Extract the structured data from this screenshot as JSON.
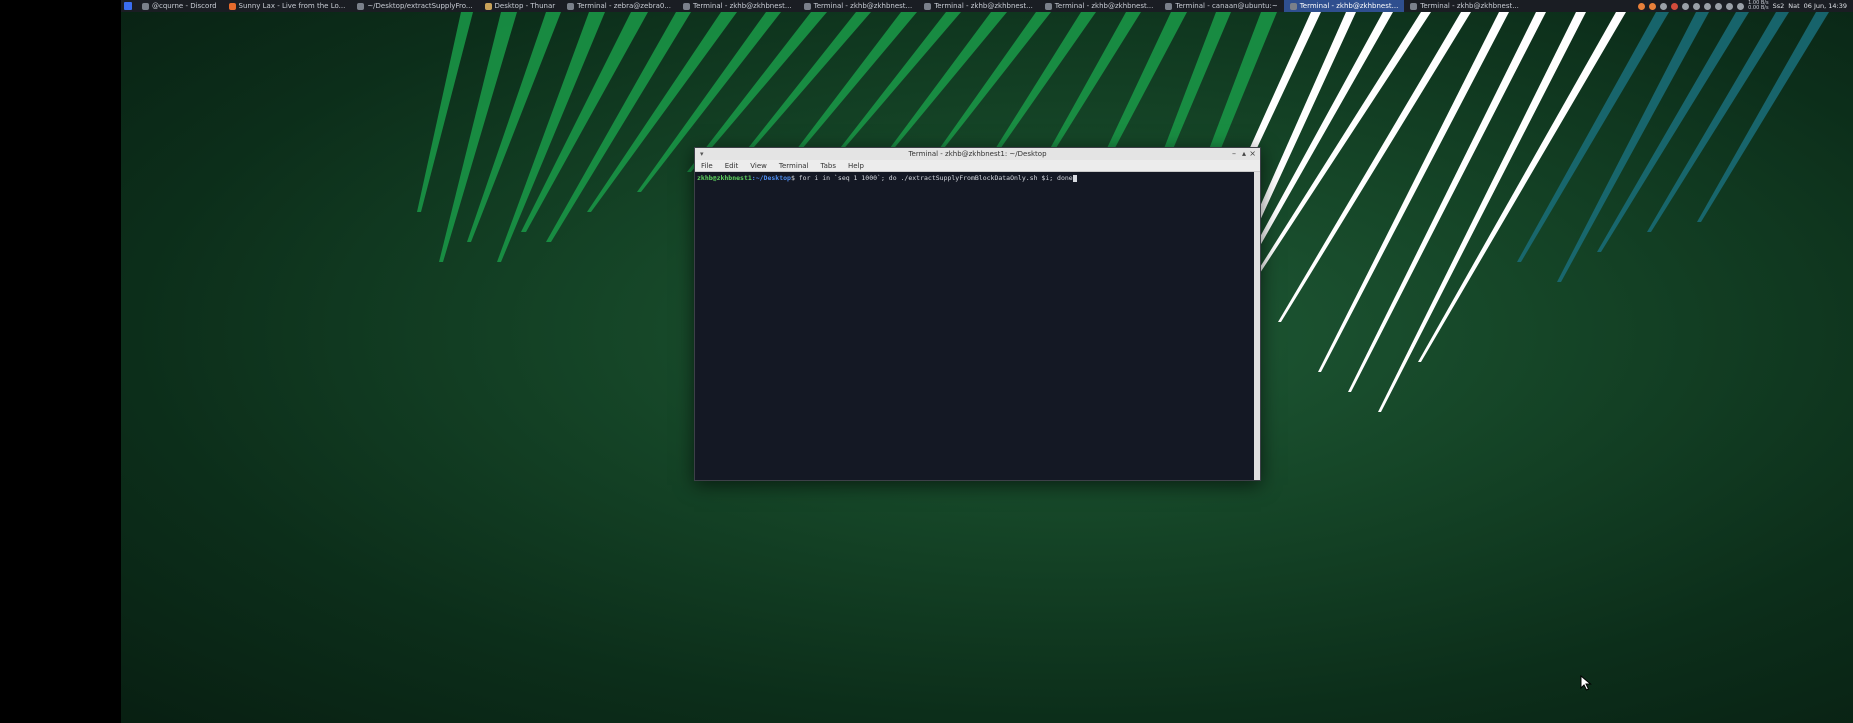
{
  "taskbar": {
    "tasks": [
      {
        "label": "@cqurne - Discord"
      },
      {
        "label": "Sunny Lax - Live from the Lo..."
      },
      {
        "label": "~/Desktop/extractSupplyFro..."
      },
      {
        "label": "Desktop - Thunar"
      },
      {
        "label": "Terminal - zebra@zebra0..."
      },
      {
        "label": "Terminal - zkhb@zkhbnest..."
      },
      {
        "label": "Terminal - zkhb@zkhbnest..."
      },
      {
        "label": "Terminal - zkhb@zkhbnest..."
      },
      {
        "label": "Terminal - zkhb@zkhbnest..."
      },
      {
        "label": "Terminal - canaan@ubuntu:~"
      },
      {
        "label": "Terminal - zkhb@zkhbnest..."
      },
      {
        "label": "Terminal - zkhb@zkhbnest..."
      }
    ],
    "active_index": 10,
    "tray": {
      "net_up": "1.00 B/s",
      "net_down": "0.00 B/s",
      "lang": "Ss2",
      "keyboard": "Nat",
      "clock": "06 Jun, 14:39"
    }
  },
  "terminal": {
    "title": "Terminal - zkhb@zkhbnest1: ~/Desktop",
    "menu": [
      "File",
      "Edit",
      "View",
      "Terminal",
      "Tabs",
      "Help"
    ],
    "prompt_user": "zkhb@zkhbnest1",
    "prompt_path": ":~/Desktop",
    "prompt_symbol": "$",
    "command": " for i in `seq 1 1000`; do ./extractSupplyFromBlockDataOnly.sh $i; done"
  },
  "colors": {
    "wallpaper_dark": "#0c2e1a",
    "stripe_green": "#1a9a48",
    "stripe_white": "#ffffff",
    "stripe_teal": "#1a6e7a",
    "terminal_bg": "#141824"
  }
}
